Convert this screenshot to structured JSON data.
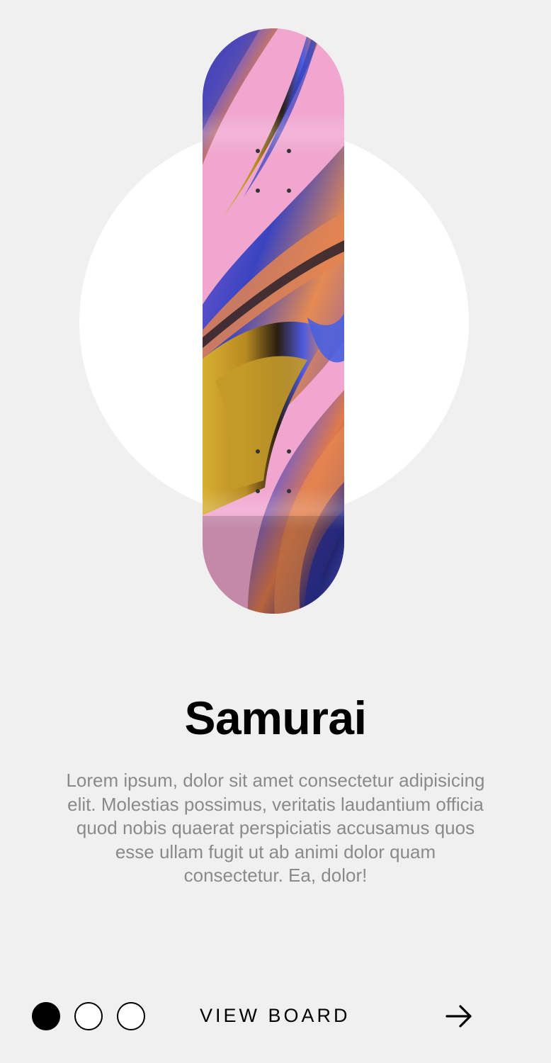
{
  "product": {
    "name": "Samurai",
    "description": "Lorem ipsum, dolor sit amet consectetur adipisicing elit. Molestias possimus, veritatis laudantium officia quod nobis quaerat perspiciatis accusamus quos esse ullam fugit ut ab animi dolor quam consectetur. Ea, dolor!",
    "image_icon": "skateboard-deck-image"
  },
  "pagination": {
    "total": 3,
    "active_index": 0
  },
  "footer": {
    "cta_label": "VIEW BOARD",
    "next_icon": "arrow-right-icon"
  },
  "colors": {
    "background": "#f0f0f0",
    "circle": "#ffffff",
    "deck_pink": "#f0a6cf",
    "text_primary": "#000000",
    "text_secondary": "#8a8a8a"
  }
}
